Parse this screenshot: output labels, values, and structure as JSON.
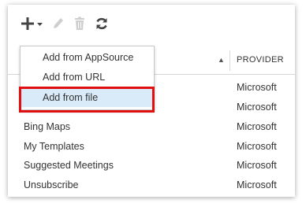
{
  "toolbar": {
    "add_icon": "plus-icon",
    "add_dropdown_icon": "caret-down-icon",
    "edit_icon": "pencil-icon",
    "delete_icon": "trash-icon",
    "refresh_icon": "refresh-icon"
  },
  "table": {
    "header": {
      "sort_indicator": "▲",
      "provider_label": "PROVIDER"
    },
    "rows": [
      {
        "name": "",
        "provider": "Microsoft"
      },
      {
        "name": "",
        "provider": "Microsoft"
      },
      {
        "name": "Bing Maps",
        "provider": "Microsoft"
      },
      {
        "name": "My Templates",
        "provider": "Microsoft"
      },
      {
        "name": "Suggested Meetings",
        "provider": "Microsoft"
      },
      {
        "name": "Unsubscribe",
        "provider": "Microsoft"
      }
    ]
  },
  "add_menu": {
    "items": [
      {
        "label": "Add from AppSource"
      },
      {
        "label": "Add from URL"
      },
      {
        "label": "Add from file"
      }
    ],
    "selected_index": 2
  },
  "colors": {
    "highlight_border": "#e01010",
    "selected_item_bg": "#d9ebf9"
  }
}
